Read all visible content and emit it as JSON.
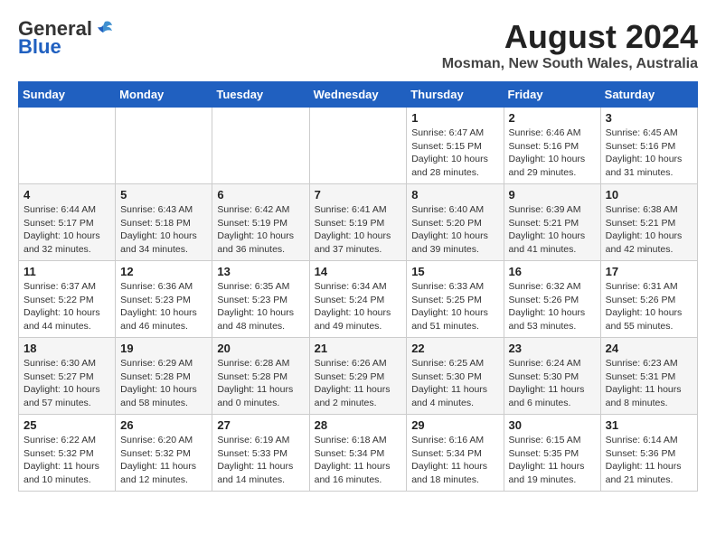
{
  "header": {
    "logo_general": "General",
    "logo_blue": "Blue",
    "main_title": "August 2024",
    "subtitle": "Mosman, New South Wales, Australia"
  },
  "calendar": {
    "days_of_week": [
      "Sunday",
      "Monday",
      "Tuesday",
      "Wednesday",
      "Thursday",
      "Friday",
      "Saturday"
    ],
    "weeks": [
      [
        {
          "day": "",
          "info": ""
        },
        {
          "day": "",
          "info": ""
        },
        {
          "day": "",
          "info": ""
        },
        {
          "day": "",
          "info": ""
        },
        {
          "day": "1",
          "info": "Sunrise: 6:47 AM\nSunset: 5:15 PM\nDaylight: 10 hours\nand 28 minutes."
        },
        {
          "day": "2",
          "info": "Sunrise: 6:46 AM\nSunset: 5:16 PM\nDaylight: 10 hours\nand 29 minutes."
        },
        {
          "day": "3",
          "info": "Sunrise: 6:45 AM\nSunset: 5:16 PM\nDaylight: 10 hours\nand 31 minutes."
        }
      ],
      [
        {
          "day": "4",
          "info": "Sunrise: 6:44 AM\nSunset: 5:17 PM\nDaylight: 10 hours\nand 32 minutes."
        },
        {
          "day": "5",
          "info": "Sunrise: 6:43 AM\nSunset: 5:18 PM\nDaylight: 10 hours\nand 34 minutes."
        },
        {
          "day": "6",
          "info": "Sunrise: 6:42 AM\nSunset: 5:19 PM\nDaylight: 10 hours\nand 36 minutes."
        },
        {
          "day": "7",
          "info": "Sunrise: 6:41 AM\nSunset: 5:19 PM\nDaylight: 10 hours\nand 37 minutes."
        },
        {
          "day": "8",
          "info": "Sunrise: 6:40 AM\nSunset: 5:20 PM\nDaylight: 10 hours\nand 39 minutes."
        },
        {
          "day": "9",
          "info": "Sunrise: 6:39 AM\nSunset: 5:21 PM\nDaylight: 10 hours\nand 41 minutes."
        },
        {
          "day": "10",
          "info": "Sunrise: 6:38 AM\nSunset: 5:21 PM\nDaylight: 10 hours\nand 42 minutes."
        }
      ],
      [
        {
          "day": "11",
          "info": "Sunrise: 6:37 AM\nSunset: 5:22 PM\nDaylight: 10 hours\nand 44 minutes."
        },
        {
          "day": "12",
          "info": "Sunrise: 6:36 AM\nSunset: 5:23 PM\nDaylight: 10 hours\nand 46 minutes."
        },
        {
          "day": "13",
          "info": "Sunrise: 6:35 AM\nSunset: 5:23 PM\nDaylight: 10 hours\nand 48 minutes."
        },
        {
          "day": "14",
          "info": "Sunrise: 6:34 AM\nSunset: 5:24 PM\nDaylight: 10 hours\nand 49 minutes."
        },
        {
          "day": "15",
          "info": "Sunrise: 6:33 AM\nSunset: 5:25 PM\nDaylight: 10 hours\nand 51 minutes."
        },
        {
          "day": "16",
          "info": "Sunrise: 6:32 AM\nSunset: 5:26 PM\nDaylight: 10 hours\nand 53 minutes."
        },
        {
          "day": "17",
          "info": "Sunrise: 6:31 AM\nSunset: 5:26 PM\nDaylight: 10 hours\nand 55 minutes."
        }
      ],
      [
        {
          "day": "18",
          "info": "Sunrise: 6:30 AM\nSunset: 5:27 PM\nDaylight: 10 hours\nand 57 minutes."
        },
        {
          "day": "19",
          "info": "Sunrise: 6:29 AM\nSunset: 5:28 PM\nDaylight: 10 hours\nand 58 minutes."
        },
        {
          "day": "20",
          "info": "Sunrise: 6:28 AM\nSunset: 5:28 PM\nDaylight: 11 hours\nand 0 minutes."
        },
        {
          "day": "21",
          "info": "Sunrise: 6:26 AM\nSunset: 5:29 PM\nDaylight: 11 hours\nand 2 minutes."
        },
        {
          "day": "22",
          "info": "Sunrise: 6:25 AM\nSunset: 5:30 PM\nDaylight: 11 hours\nand 4 minutes."
        },
        {
          "day": "23",
          "info": "Sunrise: 6:24 AM\nSunset: 5:30 PM\nDaylight: 11 hours\nand 6 minutes."
        },
        {
          "day": "24",
          "info": "Sunrise: 6:23 AM\nSunset: 5:31 PM\nDaylight: 11 hours\nand 8 minutes."
        }
      ],
      [
        {
          "day": "25",
          "info": "Sunrise: 6:22 AM\nSunset: 5:32 PM\nDaylight: 11 hours\nand 10 minutes."
        },
        {
          "day": "26",
          "info": "Sunrise: 6:20 AM\nSunset: 5:32 PM\nDaylight: 11 hours\nand 12 minutes."
        },
        {
          "day": "27",
          "info": "Sunrise: 6:19 AM\nSunset: 5:33 PM\nDaylight: 11 hours\nand 14 minutes."
        },
        {
          "day": "28",
          "info": "Sunrise: 6:18 AM\nSunset: 5:34 PM\nDaylight: 11 hours\nand 16 minutes."
        },
        {
          "day": "29",
          "info": "Sunrise: 6:16 AM\nSunset: 5:34 PM\nDaylight: 11 hours\nand 18 minutes."
        },
        {
          "day": "30",
          "info": "Sunrise: 6:15 AM\nSunset: 5:35 PM\nDaylight: 11 hours\nand 19 minutes."
        },
        {
          "day": "31",
          "info": "Sunrise: 6:14 AM\nSunset: 5:36 PM\nDaylight: 11 hours\nand 21 minutes."
        }
      ]
    ]
  }
}
